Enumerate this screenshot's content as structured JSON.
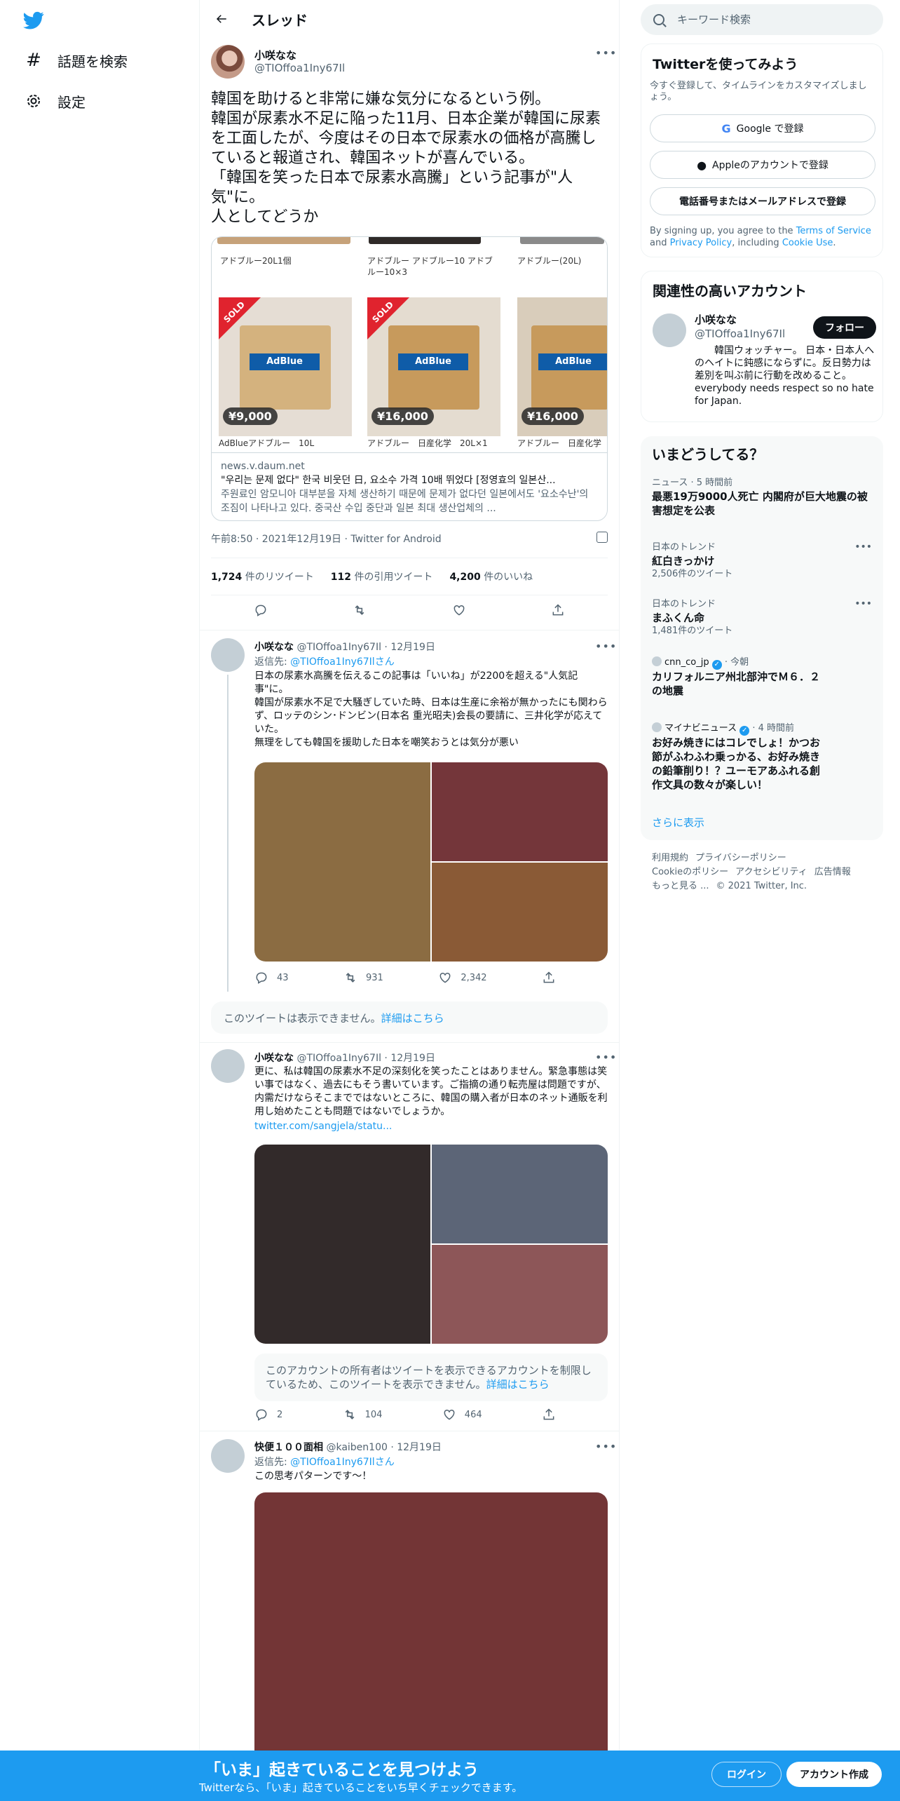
{
  "nav": {
    "logo": "twitter-bird-icon",
    "explore_label": "話題を検索",
    "settings_label": "設定"
  },
  "header": {
    "title": "スレッド"
  },
  "main_tweet": {
    "name": "小咲なな",
    "handle": "@TIOffoa1Iny67Il",
    "text": "韓国を助けると非常に嫌な気分になるという例。\n韓国が尿素水不足に陥った11月、日本企業が韓国に尿素を工面したが、今度はその日本で尿素水の価格が高騰していると報道され、韓国ネットが喜んでいる。\n「韓国を笑った日本で尿素水高騰」という記事が\"人気\"に。\n人としてどうか",
    "card": {
      "products": [
        {
          "label": "アドブルー20L1個",
          "price": "",
          "sold": false
        },
        {
          "label": "アドブルー アドブルー10 アドブルー10×3",
          "price": "",
          "sold": false
        },
        {
          "label": "アドブルー(20L)",
          "price": "",
          "sold": false
        }
      ],
      "items": [
        {
          "label": "AdBlueアドブルー　10L",
          "price": "¥9,000",
          "sold": true,
          "box": "AdBlue"
        },
        {
          "label": "アドブルー　日産化学　20L×1",
          "price": "¥16,000",
          "sold": true,
          "box": "AdBlue"
        },
        {
          "label": "アドブルー　日産化学",
          "price": "¥16,000",
          "sold": false,
          "box": "AdBlue"
        }
      ],
      "sold_text": "SOLD",
      "domain": "news.v.daum.net",
      "title": "\"우리는 문제 없다\" 한국 비웃던 日, 요소수 가격 10배 뛰었다 [정영효의 일본산...",
      "description": "주원료인 암모니아 대부분을 자체 생산하기 때문에 문제가 없다던 일본에서도 '요소수난'의 조짐이 나타나고 있다. 중국산 수입 중단과 일본 최대 생산업체의 ..."
    },
    "timestamp": "午前8:50 · 2021年12月19日 · Twitter for Android",
    "stats": {
      "retweets_num": "1,724",
      "retweets_label": "件のリツイート",
      "quotes_num": "112",
      "quotes_label": "件の引用ツイート",
      "likes_num": "4,200",
      "likes_label": "件のいいね"
    }
  },
  "replies": [
    {
      "name": "小咲なな",
      "meta": "@TIOffoa1Iny67Il · 12月19日",
      "reply_prefix": "返信先: ",
      "reply_to": "@TIOffoa1Iny67Ilさん",
      "text": "日本の尿素水高騰を伝えるこの記事は「いいね」が2200を超える\"人気記事\"に。\n韓国が尿素水不足で大騒ぎしていた時、日本は生産に余裕が無かったにも関わらず、ロッテのシン･ドンビン(日本名 重光昭夫)会長の要請に、三井化学が応えていた。\n無理をしても韓国を援助した日本を嘲笑おうとは気分が悪い",
      "replies": "43",
      "retweets": "931",
      "likes": "2,342",
      "media_colors": [
        "#8b6c42",
        "#74363a",
        "#8a5a36"
      ]
    },
    {
      "name": "小咲なな",
      "meta": "@TIOffoa1Iny67Il · 12月19日",
      "text": "更に、私は韓国の尿素水不足の深刻化を笑ったことはありません。緊急事態は笑い事ではなく、過去にもそう書いています。ご指摘の通り転売屋は問題ですが、内需だけならそこまでではないところに、韓国の購入者が日本のネット通販を利用し始めたことも問題ではないでしょうか。",
      "link": "twitter.com/sangjela/statu...",
      "restricted_notice": "このアカウントの所有者はツイートを表示できるアカウントを制限しているため、このツイートを表示できません。",
      "restricted_link": "詳細はこちら",
      "replies": "2",
      "retweets": "104",
      "likes": "464",
      "media_colors": [
        "#322a2a",
        "#5c6577",
        "#8d5658"
      ]
    },
    {
      "name": "快便１００面相",
      "meta": "@kaiben100 · 12月19日",
      "reply_prefix": "返信先: ",
      "reply_to": "@TIOffoa1Iny67Ilさん",
      "text": "この思考パターンです～！",
      "media_colors": [
        "#733536"
      ]
    }
  ],
  "unavailable_notice": {
    "text": "このツイートは表示できません。",
    "link": "詳細はこちら"
  },
  "sidebar": {
    "search_placeholder": "キーワード検索",
    "signup": {
      "title": "Twitterを使ってみよう",
      "subtitle": "今すぐ登録して、タイムラインをカスタマイズしましょう。",
      "google": "Google で登録",
      "apple": "Appleのアカウントで登録",
      "phone": "電話番号またはメールアドレスで登録",
      "legal_prefix": "By signing up, you agree to the ",
      "terms": "Terms of Service",
      "and": " and ",
      "privacy": "Privacy Policy",
      "including": ", including ",
      "cookie": "Cookie Use",
      "period": "."
    },
    "relevant": {
      "title": "関連性の高いアカウント",
      "name": "小咲なな",
      "handle": "@TIOffoa1Iny67Il",
      "follow": "フォロー",
      "bio": "　　韓国ウォッチャー。 日本・日本人へのヘイトに鈍感にならずに。反日勢力は差別を叫ぶ前に行動を改めること。 everybody needs respect so no hate for Japan."
    },
    "trends": {
      "title": "いまどうしてる？",
      "items": [
        {
          "meta": "ニュース · 5 時間前",
          "title": "最悪19万9000人死亡 内閣府が巨大地震の被害想定を公表",
          "count": ""
        },
        {
          "meta": "日本のトレンド",
          "title": "紅白きっかけ",
          "count": "2,506件のツイート"
        },
        {
          "meta": "日本のトレンド",
          "title": "まふくん命",
          "count": "1,481件のツイート"
        },
        {
          "meta": "cnn_co_jp",
          "meta_time": " · 今朝",
          "title": "カリフォルニア州北部沖でＭ６．２の地震",
          "count": ""
        },
        {
          "meta": "マイナビニュース",
          "meta_time": " · 4 時間前",
          "title": "お好み焼きにはコレでしょ！かつお節がふわふわ乗っかる、お好み焼きの鉛筆削り！？ユーモアあふれる創作文具の数々が楽しい！",
          "count": ""
        }
      ],
      "show_more": "さらに表示"
    },
    "footer": {
      "terms": "利用規約",
      "privacy": "プライバシーポリシー",
      "cookie": "Cookieのポリシー",
      "accessibility": "アクセシビリティ",
      "ads": "広告情報",
      "more": "もっと見る ...",
      "copyright": "© 2021 Twitter, Inc."
    }
  },
  "bottom_bar": {
    "title": "「いま」起きていることを見つけよう",
    "subtitle": "Twitterなら、「いま」起きていることをいち早くチェックできます。",
    "login": "ログイン",
    "signup": "アカウント作成"
  },
  "colors": {
    "accent": "#1d9bf0",
    "text": "#0f1419",
    "muted": "#536471"
  }
}
